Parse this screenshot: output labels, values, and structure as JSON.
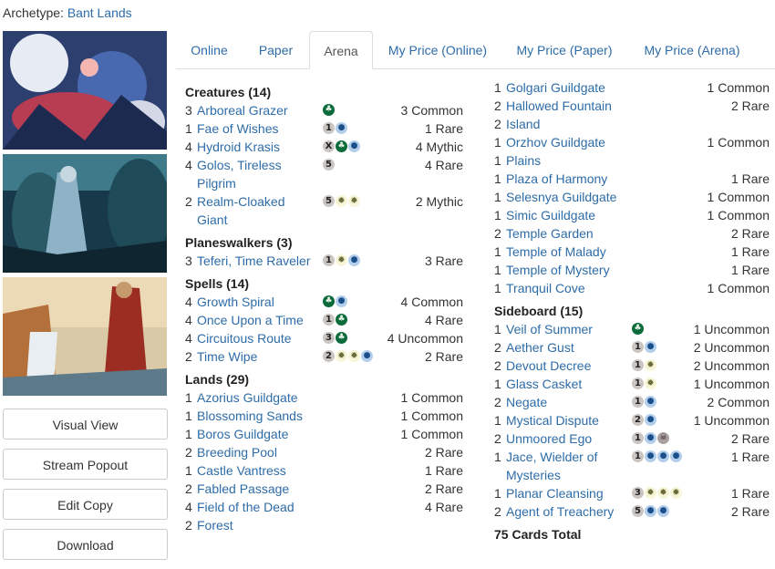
{
  "archetype": {
    "label": "Archetype:",
    "value": "Bant Lands"
  },
  "tabs": [
    "Online",
    "Paper",
    "Arena",
    "My Price (Online)",
    "My Price (Paper)",
    "My Price (Arena)"
  ],
  "active_tab": "Arena",
  "side_buttons": [
    "Visual View",
    "Stream Popout",
    "Edit Copy",
    "Download"
  ],
  "colors": {
    "link": "#2e6ca8",
    "green_mana": "#0b6b3a",
    "blue_mana": "#b3ceea",
    "white_mana": "#f8f6d8",
    "generic_mana": "#cac5c0"
  },
  "column1": [
    {
      "header": "Creatures (14)",
      "cards": [
        {
          "qty": "3",
          "name": "Arboreal Grazer",
          "mana": [
            "G"
          ],
          "rarity": "3 Common"
        },
        {
          "qty": "1",
          "name": "Fae of Wishes",
          "mana": [
            "1",
            "U"
          ],
          "rarity": "1 Rare"
        },
        {
          "qty": "4",
          "name": "Hydroid Krasis",
          "mana": [
            "X",
            "G",
            "U"
          ],
          "rarity": "4 Mythic"
        },
        {
          "qty": "4",
          "name": "Golos, Tireless Pilgrim",
          "mana": [
            "5"
          ],
          "rarity": "4 Rare"
        },
        {
          "qty": "2",
          "name": "Realm-Cloaked Giant",
          "mana": [
            "5",
            "W",
            "W"
          ],
          "rarity": "2 Mythic"
        }
      ]
    },
    {
      "header": "Planeswalkers (3)",
      "cards": [
        {
          "qty": "3",
          "name": "Teferi, Time Raveler",
          "mana": [
            "1",
            "W",
            "U"
          ],
          "rarity": "3 Rare"
        }
      ]
    },
    {
      "header": "Spells (14)",
      "cards": [
        {
          "qty": "4",
          "name": "Growth Spiral",
          "mana": [
            "G",
            "U"
          ],
          "rarity": "4 Common"
        },
        {
          "qty": "4",
          "name": "Once Upon a Time",
          "mana": [
            "1",
            "G"
          ],
          "rarity": "4 Rare"
        },
        {
          "qty": "4",
          "name": "Circuitous Route",
          "mana": [
            "3",
            "G"
          ],
          "rarity": "4 Uncommon"
        },
        {
          "qty": "2",
          "name": "Time Wipe",
          "mana": [
            "2",
            "W",
            "W",
            "U"
          ],
          "rarity": "2 Rare"
        }
      ]
    },
    {
      "header": "Lands (29)",
      "cards": [
        {
          "qty": "1",
          "name": "Azorius Guildgate",
          "mana": [],
          "rarity": "1 Common"
        },
        {
          "qty": "1",
          "name": "Blossoming Sands",
          "mana": [],
          "rarity": "1 Common"
        },
        {
          "qty": "1",
          "name": "Boros Guildgate",
          "mana": [],
          "rarity": "1 Common"
        },
        {
          "qty": "2",
          "name": "Breeding Pool",
          "mana": [],
          "rarity": "2 Rare"
        },
        {
          "qty": "1",
          "name": "Castle Vantress",
          "mana": [],
          "rarity": "1 Rare"
        },
        {
          "qty": "2",
          "name": "Fabled Passage",
          "mana": [],
          "rarity": "2 Rare"
        },
        {
          "qty": "4",
          "name": "Field of the Dead",
          "mana": [],
          "rarity": "4 Rare"
        },
        {
          "qty": "2",
          "name": "Forest",
          "mana": [],
          "rarity": ""
        }
      ]
    }
  ],
  "column2": [
    {
      "header": "",
      "cards": [
        {
          "qty": "1",
          "name": "Golgari Guildgate",
          "mana": [],
          "rarity": "1 Common"
        },
        {
          "qty": "2",
          "name": "Hallowed Fountain",
          "mana": [],
          "rarity": "2 Rare"
        },
        {
          "qty": "2",
          "name": "Island",
          "mana": [],
          "rarity": ""
        },
        {
          "qty": "1",
          "name": "Orzhov Guildgate",
          "mana": [],
          "rarity": "1 Common"
        },
        {
          "qty": "1",
          "name": "Plains",
          "mana": [],
          "rarity": ""
        },
        {
          "qty": "1",
          "name": "Plaza of Harmony",
          "mana": [],
          "rarity": "1 Rare"
        },
        {
          "qty": "1",
          "name": "Selesnya Guildgate",
          "mana": [],
          "rarity": "1 Common"
        },
        {
          "qty": "1",
          "name": "Simic Guildgate",
          "mana": [],
          "rarity": "1 Common"
        },
        {
          "qty": "2",
          "name": "Temple Garden",
          "mana": [],
          "rarity": "2 Rare"
        },
        {
          "qty": "1",
          "name": "Temple of Malady",
          "mana": [],
          "rarity": "1 Rare"
        },
        {
          "qty": "1",
          "name": "Temple of Mystery",
          "mana": [],
          "rarity": "1 Rare"
        },
        {
          "qty": "1",
          "name": "Tranquil Cove",
          "mana": [],
          "rarity": "1 Common"
        }
      ]
    },
    {
      "header": "Sideboard (15)",
      "cards": [
        {
          "qty": "1",
          "name": "Veil of Summer",
          "mana": [
            "G"
          ],
          "rarity": "1 Uncommon"
        },
        {
          "qty": "2",
          "name": "Aether Gust",
          "mana": [
            "1",
            "U"
          ],
          "rarity": "2 Uncommon"
        },
        {
          "qty": "2",
          "name": "Devout Decree",
          "mana": [
            "1",
            "W"
          ],
          "rarity": "2 Uncommon"
        },
        {
          "qty": "1",
          "name": "Glass Casket",
          "mana": [
            "1",
            "W"
          ],
          "rarity": "1 Uncommon"
        },
        {
          "qty": "2",
          "name": "Negate",
          "mana": [
            "1",
            "U"
          ],
          "rarity": "2 Common"
        },
        {
          "qty": "1",
          "name": "Mystical Dispute",
          "mana": [
            "2",
            "U"
          ],
          "rarity": "1 Uncommon"
        },
        {
          "qty": "2",
          "name": "Unmoored Ego",
          "mana": [
            "1",
            "U",
            "B"
          ],
          "rarity": "2 Rare"
        },
        {
          "qty": "1",
          "name": "Jace, Wielder of Mysteries",
          "mana": [
            "1",
            "U",
            "U",
            "U"
          ],
          "rarity": "1 Rare"
        },
        {
          "qty": "1",
          "name": "Planar Cleansing",
          "mana": [
            "3",
            "W",
            "W",
            "W"
          ],
          "rarity": "1 Rare"
        },
        {
          "qty": "2",
          "name": "Agent of Treachery",
          "mana": [
            "5",
            "U",
            "U"
          ],
          "rarity": "2 Rare"
        }
      ]
    }
  ],
  "total": "75 Cards Total"
}
